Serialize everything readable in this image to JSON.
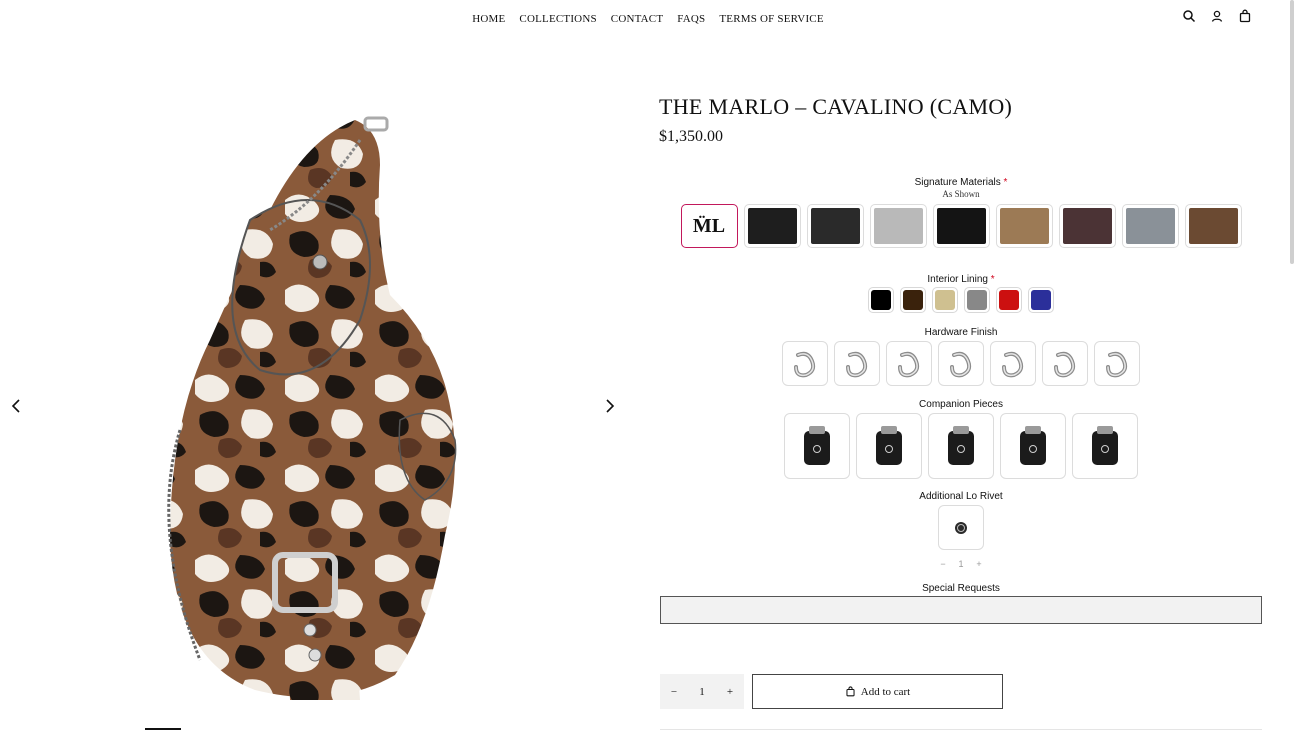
{
  "nav": {
    "items": [
      "HOME",
      "COLLECTIONS",
      "CONTACT",
      "FAQS",
      "TERMS OF SERVICE"
    ]
  },
  "header_icons": [
    "search-icon",
    "account-icon",
    "cart-bag-icon"
  ],
  "product": {
    "title": "THE MARLO – CAVALINO (CAMO)",
    "price": "$1,350.00"
  },
  "options": {
    "signature_materials": {
      "label": "Signature Materials",
      "required_mark": "*",
      "selected_value": "As Shown",
      "swatches": [
        {
          "name": "as-shown-logo",
          "text": "M̈L",
          "color": "#ffffff"
        },
        {
          "name": "black-leather-1",
          "color": "#1e1e1e"
        },
        {
          "name": "black-pebbled",
          "color": "#2a2a2a"
        },
        {
          "name": "grey-snake",
          "color": "#b9b9b9"
        },
        {
          "name": "black-satin",
          "color": "#141414"
        },
        {
          "name": "tan-suede",
          "color": "#9c7a55"
        },
        {
          "name": "dark-brown",
          "color": "#4b3335"
        },
        {
          "name": "grey-felt",
          "color": "#8a9198"
        },
        {
          "name": "camo-pony",
          "color": "#6b4a32"
        }
      ]
    },
    "interior_lining": {
      "label": "Interior Lining",
      "required_mark": "*",
      "swatches": [
        {
          "name": "black",
          "color": "#000000"
        },
        {
          "name": "brown",
          "color": "#3a220c"
        },
        {
          "name": "beige",
          "color": "#cfc090"
        },
        {
          "name": "grey",
          "color": "#888888"
        },
        {
          "name": "red",
          "color": "#cc1010"
        },
        {
          "name": "blue",
          "color": "#2b2f9a"
        }
      ]
    },
    "hardware_finish": {
      "label": "Hardware Finish",
      "items": [
        "hardware-b-charm",
        "hardware-b-chunky",
        "hardware-s-twist",
        "hardware-3-charm",
        "hardware-shackle",
        "hardware-ring",
        "hardware-hook-charm"
      ]
    },
    "companion_pieces": {
      "label": "Companion Pieces",
      "items": [
        "flask-pouch",
        "lighter-case",
        "key-holder",
        "jar-pouch",
        "card-wallet"
      ]
    },
    "additional_rivet": {
      "label": "Additional Lo Rivet",
      "quantity": "1",
      "minus": "−",
      "plus": "+"
    },
    "special_requests": {
      "label": "Special Requests",
      "value": ""
    }
  },
  "purchase": {
    "quantity": "1",
    "minus": "−",
    "plus": "+",
    "add_to_cart": "Add to cart"
  }
}
